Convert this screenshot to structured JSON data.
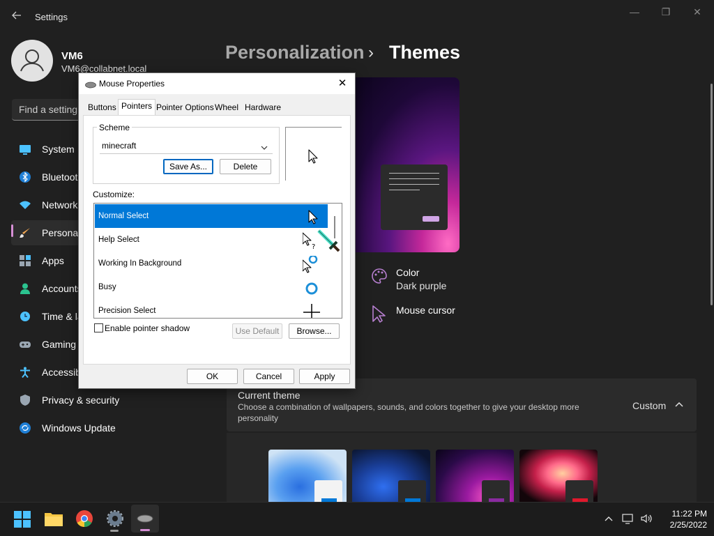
{
  "window": {
    "title": "Settings"
  },
  "profile": {
    "name": "VM6",
    "email": "VM6@collabnet.local"
  },
  "search": {
    "placeholder": "Find a setting"
  },
  "sidebar": {
    "items": [
      {
        "label": "System",
        "icon": "monitor-icon"
      },
      {
        "label": "Bluetooth & devices",
        "icon": "bluetooth-icon"
      },
      {
        "label": "Network & internet",
        "icon": "wifi-icon"
      },
      {
        "label": "Personalization",
        "icon": "brush-icon",
        "selected": true
      },
      {
        "label": "Apps",
        "icon": "apps-icon"
      },
      {
        "label": "Accounts",
        "icon": "person-icon"
      },
      {
        "label": "Time & language",
        "icon": "clock-globe-icon"
      },
      {
        "label": "Gaming",
        "icon": "gamepad-icon"
      },
      {
        "label": "Accessibility",
        "icon": "accessibility-icon"
      },
      {
        "label": "Privacy & security",
        "icon": "shield-icon"
      },
      {
        "label": "Windows Update",
        "icon": "update-icon"
      }
    ]
  },
  "breadcrumb": {
    "parent": "Personalization",
    "separator": "›",
    "current": "Themes"
  },
  "theme_settings": {
    "color_label": "Color",
    "color_value": "Dark purple",
    "cursor_label": "Mouse cursor"
  },
  "current_theme": {
    "title": "Current theme",
    "description": "Choose a combination of wallpapers, sounds, and colors together to give your desktop more personality",
    "value": "Custom"
  },
  "dialog": {
    "title": "Mouse Properties",
    "tabs": [
      "Buttons",
      "Pointers",
      "Pointer Options",
      "Wheel",
      "Hardware"
    ],
    "active_tab": "Pointers",
    "scheme_label": "Scheme",
    "scheme_value": "minecraft",
    "save_as": "Save As...",
    "delete": "Delete",
    "customize_label": "Customize:",
    "rows": [
      "Normal Select",
      "Help Select",
      "Working In Background",
      "Busy",
      "Precision Select"
    ],
    "shadow_label": "Enable pointer shadow",
    "use_default": "Use Default",
    "browse": "Browse...",
    "ok": "OK",
    "cancel": "Cancel",
    "apply": "Apply"
  },
  "taskbar": {
    "time": "11:22 PM",
    "date": "2/25/2022"
  },
  "colors": {
    "accent": "#0078d7",
    "purple": "#b77fd0",
    "bg": "#202020"
  }
}
